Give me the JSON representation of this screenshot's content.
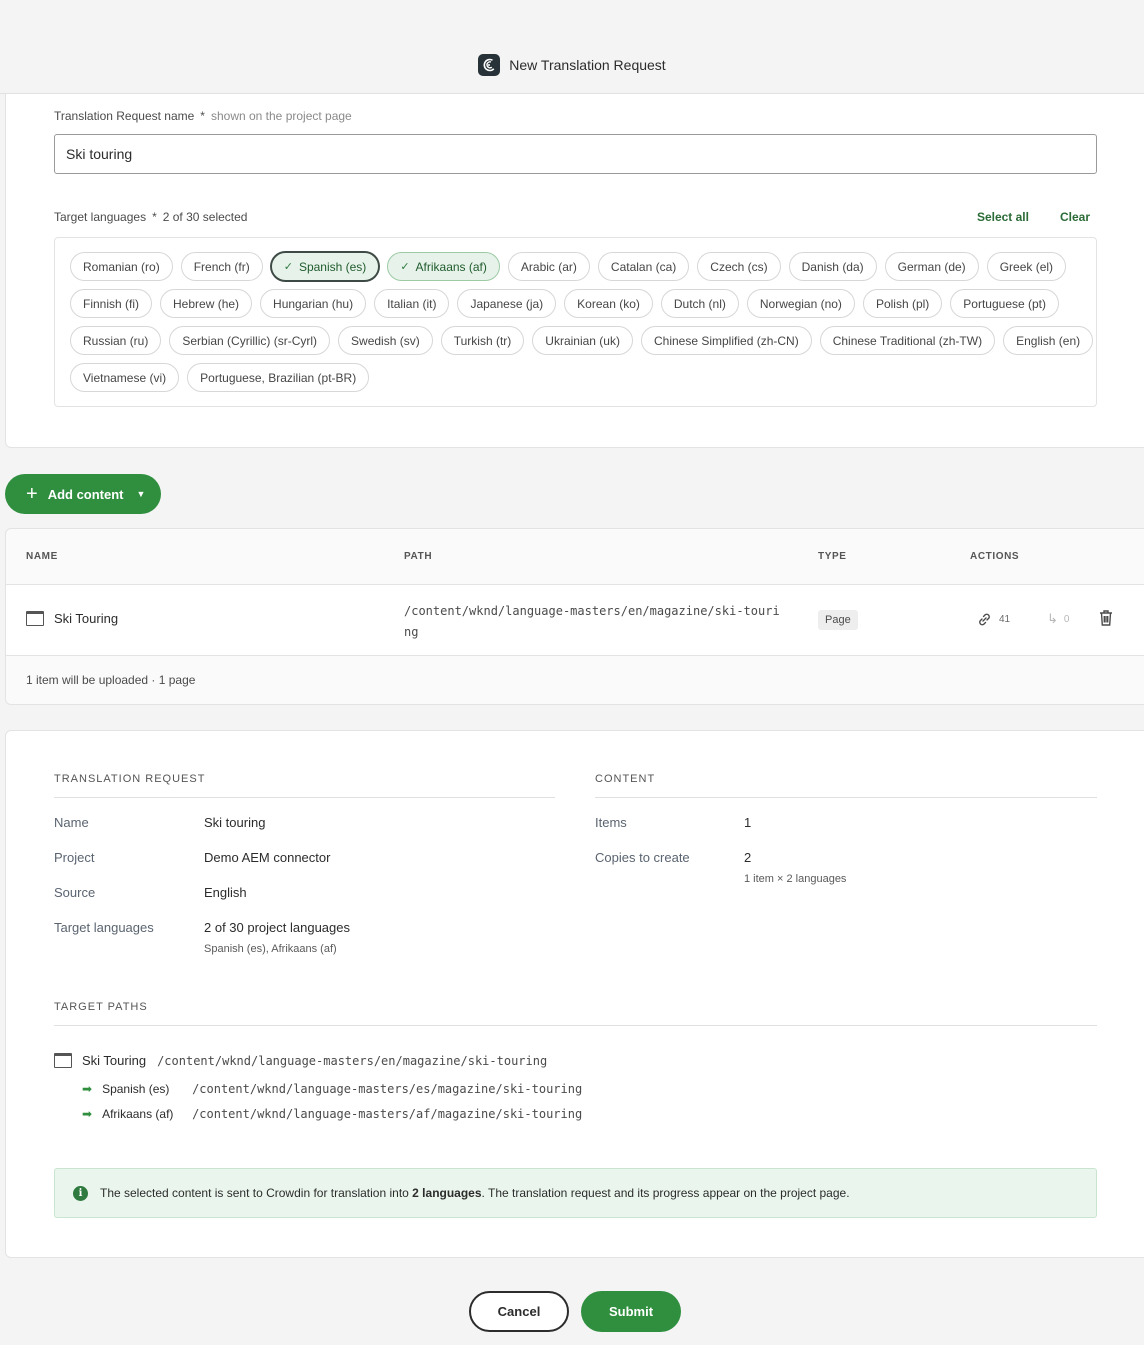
{
  "header": {
    "title": "New Translation Request",
    "logo_icon": "crowdin-logo-icon"
  },
  "form": {
    "name_label": "Translation Request name",
    "required_mark": "*",
    "name_hint": "shown on the project page",
    "name_value": "Ski touring",
    "languages_label": "Target languages",
    "languages_count": "2 of 30 selected",
    "select_all": "Select all",
    "clear": "Clear",
    "languages": [
      "Romanian (ro)",
      "French (fr)",
      "Spanish (es)",
      "Afrikaans (af)",
      "Arabic (ar)",
      "Catalan (ca)",
      "Czech (cs)",
      "Danish (da)",
      "German (de)",
      "Greek (el)",
      "Finnish (fi)",
      "Hebrew (he)",
      "Hungarian (hu)",
      "Italian (it)",
      "Japanese (ja)",
      "Korean (ko)",
      "Dutch (nl)",
      "Norwegian (no)",
      "Polish (pl)",
      "Portuguese (pt)",
      "Russian (ru)",
      "Serbian (Cyrillic) (sr-Cyrl)",
      "Swedish (sv)",
      "Turkish (tr)",
      "Ukrainian (uk)",
      "Chinese Simplified (zh-CN)",
      "Chinese Traditional (zh-TW)",
      "English (en)",
      "Vietnamese (vi)",
      "Portuguese, Brazilian (pt-BR)"
    ]
  },
  "add_content": {
    "label": "Add content"
  },
  "table": {
    "headers": {
      "name": "NAME",
      "path": "PATH",
      "type": "TYPE",
      "actions": "ACTIONS"
    },
    "rows": [
      {
        "name": "Ski Touring",
        "path": "/content/wknd/language-masters/en/magazine/ski-touring",
        "type": "Page",
        "links_count": "41",
        "refs_count": "0"
      }
    ],
    "footer": "1 item will be uploaded · 1 page"
  },
  "summary": {
    "request_title": "TRANSLATION REQUEST",
    "content_title": "CONTENT",
    "name_key": "Name",
    "name_val": "Ski touring",
    "project_key": "Project",
    "project_val": "Demo AEM connector",
    "source_key": "Source",
    "source_val": "English",
    "targets_key": "Target languages",
    "targets_val": "2 of 30 project languages",
    "targets_sub": "Spanish (es), Afrikaans (af)",
    "items_key": "Items",
    "items_val": "1",
    "copies_key": "Copies to create",
    "copies_val": "2",
    "copies_sub": "1 item × 2 languages",
    "paths_title": "TARGET PATHS",
    "source_name": "Ski Touring",
    "source_path": "/content/wknd/language-masters/en/magazine/ski-touring",
    "targets": [
      {
        "lang": "Spanish (es)",
        "path": "/content/wknd/language-masters/es/magazine/ski-touring"
      },
      {
        "lang": "Afrikaans (af)",
        "path": "/content/wknd/language-masters/af/magazine/ski-touring"
      }
    ],
    "info_pre": "The selected content is sent to Crowdin for translation into ",
    "info_bold": "2 languages",
    "info_post": ". The translation request and its progress appear on the project page."
  },
  "buttons": {
    "cancel": "Cancel",
    "submit": "Submit"
  },
  "colors": {
    "accent": "#2f8f3f",
    "selected_chip_bg": "#e7f3ea",
    "info_bg": "#eaf6ed"
  }
}
